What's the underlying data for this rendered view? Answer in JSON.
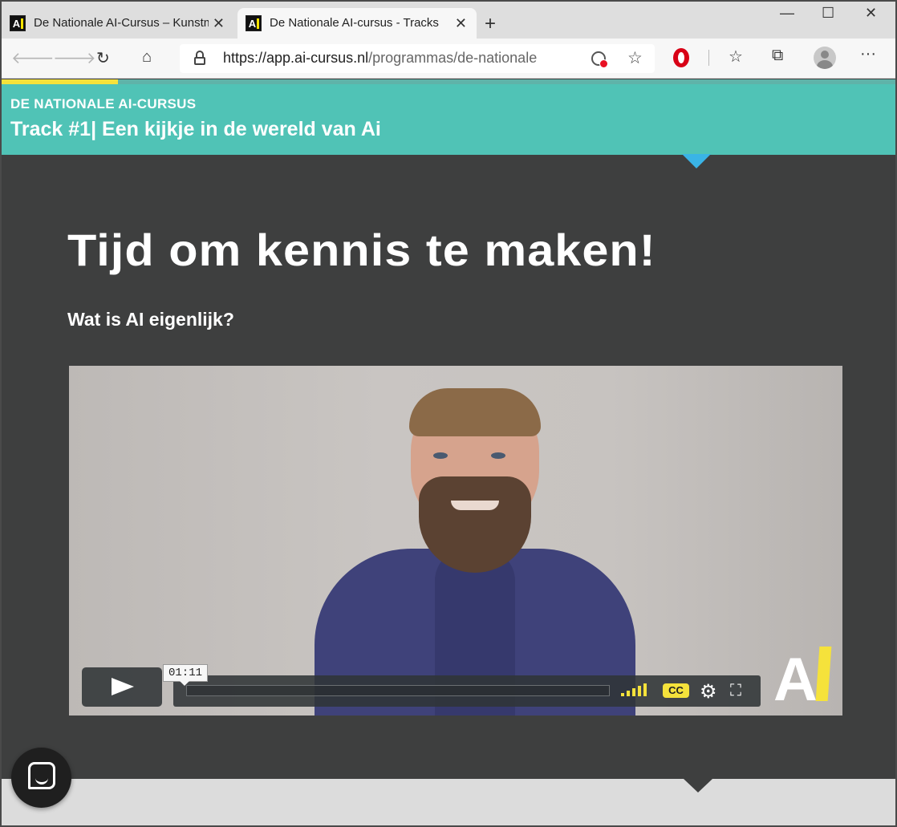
{
  "browser": {
    "tabs": [
      {
        "title": "De Nationale AI-Cursus – Kunstmatige",
        "favicon": "ai-logo-icon",
        "active": false
      },
      {
        "title": "De Nationale AI-cursus - Tracks",
        "favicon": "ai-logo-icon",
        "active": true
      }
    ],
    "url_host": "https://app.ai-cursus.nl",
    "url_path": "/programmas/de-nationale",
    "favicon_text": "A",
    "window_controls": {
      "minimize": "—",
      "maximize": "☐",
      "close": "✕"
    },
    "toolbar_icons": [
      "back-icon",
      "forward-icon",
      "reload-icon",
      "home-icon",
      "lock-icon",
      "cookie-blocked-icon",
      "star-icon",
      "opera-icon",
      "favorites-icon",
      "collections-icon",
      "profile-icon",
      "more-icon"
    ]
  },
  "page": {
    "progress_fraction": 0.13,
    "course_name": "DE NATIONALE AI-CURSUS",
    "track_title": "Track #1| Een kijkje in de wereld van Ai",
    "headline": "Tijd om kennis te maken!",
    "subheadline": "Wat is AI eigenlijk?",
    "video": {
      "time_tooltip": "01:11",
      "played_fraction": 0.0,
      "cc_label": "CC",
      "logo_text": "A"
    }
  },
  "colors": {
    "teal_header": "#50c3b6",
    "accent_yellow": "#f5e23b",
    "content_bg": "#3e3f3f",
    "notch_blue": "#3ab4e6"
  }
}
